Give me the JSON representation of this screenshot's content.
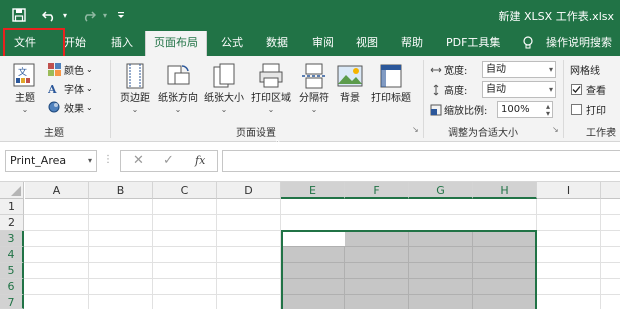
{
  "titlebar": {
    "save_icon": "save-icon",
    "undo_icon": "undo-icon",
    "redo_icon": "redo-icon",
    "customize_icon": "customize-quick-access-icon",
    "doc_title": "新建 XLSX 工作表.xlsx"
  },
  "tabs": [
    {
      "label": "文件"
    },
    {
      "label": "开始"
    },
    {
      "label": "插入"
    },
    {
      "label": "页面布局",
      "active": true
    },
    {
      "label": "公式"
    },
    {
      "label": "数据"
    },
    {
      "label": "审阅"
    },
    {
      "label": "视图"
    },
    {
      "label": "帮助"
    },
    {
      "label": "PDF工具集"
    },
    {
      "label": "操作说明搜索"
    }
  ],
  "ribbon": {
    "themes_group": {
      "theme_button": "主题",
      "colors": "颜色",
      "fonts": "字体",
      "effects": "效果",
      "label": "主题"
    },
    "page_setup_group": {
      "margins": "页边距",
      "orientation": "纸张方向",
      "size": "纸张大小",
      "print_area": "打印区域",
      "breaks": "分隔符",
      "background": "背景",
      "print_titles": "打印标题",
      "label": "页面设置"
    },
    "scale_group": {
      "width_label": "宽度:",
      "width_value": "自动",
      "height_label": "高度:",
      "height_value": "自动",
      "scale_label": "缩放比例:",
      "scale_value": "100%",
      "label": "调整为合适大小"
    },
    "sheet_options_group": {
      "gridlines": "网格线",
      "view": "查看",
      "print": "打印",
      "label": "工作表"
    }
  },
  "formula_bar": {
    "name_box": "Print_Area",
    "cancel_icon": "cancel-icon",
    "confirm_icon": "confirm-icon",
    "fx": "fx",
    "formula": ""
  },
  "grid": {
    "columns": [
      "A",
      "B",
      "C",
      "D",
      "E",
      "F",
      "G",
      "H",
      "I"
    ],
    "rows": [
      "1",
      "2",
      "3",
      "4",
      "5",
      "6",
      "7"
    ],
    "selected_columns": [
      "E",
      "F",
      "G",
      "H"
    ],
    "selected_rows": [
      "3",
      "4",
      "5",
      "6",
      "7"
    ]
  },
  "colors": {
    "accent": "#217346",
    "highlight": "#e8231f",
    "selection_fill": "#c6c6c6"
  }
}
